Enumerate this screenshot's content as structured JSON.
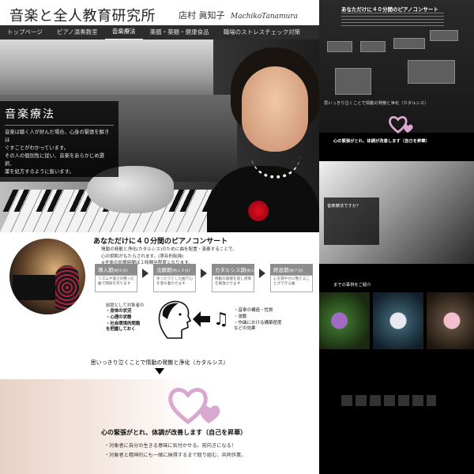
{
  "header": {
    "site_title": "音楽と全人教育研究所",
    "author": "店村 眞知子",
    "author_en": "MachikoTanamura"
  },
  "nav": {
    "items": [
      "トップページ",
      "ピアノ演奏教室",
      "音楽療法",
      "薬膳・薬糖・健康食品",
      "職場のストレスチェック対策"
    ],
    "active": "音楽療法"
  },
  "hero": {
    "title": "音楽療法",
    "text": [
      "音楽は聴く人が好んだ場合、心身の緊張を解きほ",
      "ぐすことがわかっています。",
      "その人の個別性に従い、音楽をあらかじめ選択、",
      "薬を処方するように扱います。"
    ]
  },
  "concert": {
    "title": "あなただけに４０分間のピアノコンサート",
    "desc": [
      "情動の発散と浄化(カタルシス)のために曲を配置・演奏することで、",
      "心の調和がもたらされます。(実存的転換)",
      "※全体の診療時間は１時間半程度となります。"
    ],
    "steps": [
      {
        "label": "導入期",
        "time": "(約５分)",
        "body": "リズムや速さの整った曲で関係を作ります"
      },
      {
        "label": "沈静期",
        "time": "(約１０分)",
        "body": "ゆったりとした曲で心を落ち着かせます"
      },
      {
        "label": "カタルシス期",
        "time": "(約１５分)",
        "body": "情動の発散を促し感情を解放させます"
      },
      {
        "label": "終息期",
        "time": "(約７分)",
        "body": "心を穏やかに整えることができる曲"
      }
    ],
    "lead": "前提として対象者の",
    "conditions": [
      "・身体の状況",
      "・心理の状態",
      "・社会環境的問題",
      "を把握しておく"
    ],
    "music_factors": [
      "・音楽の構造・性質",
      "・波動",
      "・作曲における構築密度",
      "などの効果"
    ],
    "catharsis": "思いっきり泣くことで情動の発散と浄化（カタルシス）"
  },
  "result": {
    "title": "心の緊張がとれ、体調が改善します（自己を昇華）",
    "items": [
      "・対象者に自分の生きる意味に気付かせる。前向きになる！",
      "・対象者と精神的にも一緒に納得するまで取り組む、共同作業。"
    ]
  },
  "preview": {
    "title": "あなただけに４０分間のピアノコンサート",
    "result": "心の緊張がとれ、体調が改善します（自己を昇華）",
    "catharsis": "思いっきり泣くことで情動の発散と浄化（カタルシス）",
    "question": "音楽療法ですか？",
    "flowers_title": "までの事例をご紹介"
  },
  "colors": {
    "nav_bg": "#2c2c2c",
    "heart": "#d9a8cf",
    "accent_dark": "#000000"
  }
}
